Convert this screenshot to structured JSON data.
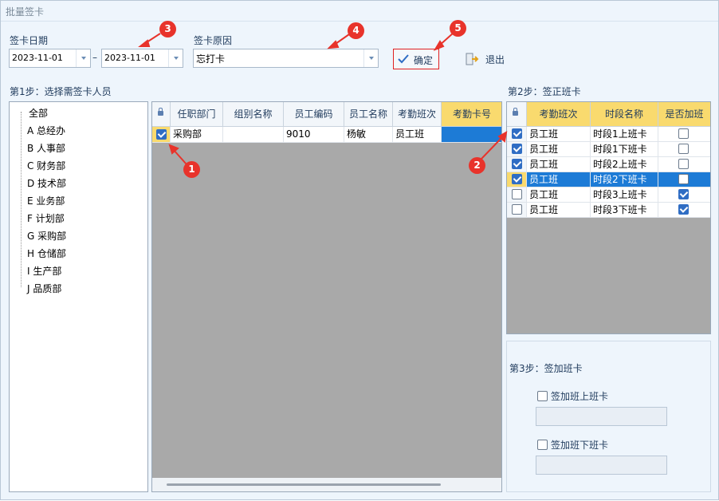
{
  "window": {
    "title": "批量签卡"
  },
  "form": {
    "date_label": "签卡日期",
    "date_from": "2023-11-01",
    "date_sep": "–",
    "date_to": "2023-11-01",
    "reason_label": "签卡原因",
    "reason_value": "忘打卡",
    "confirm_label": "确定",
    "exit_label": "退出"
  },
  "step1": {
    "title": "第1步：选择需签卡人员",
    "tree": [
      "全部",
      "A 总经办",
      "B 人事部",
      "C 财务部",
      "D 技术部",
      "E 业务部",
      "F 计划部",
      "G 采购部",
      "H 仓储部",
      "I 生产部",
      "J 品质部"
    ],
    "columns": [
      "任职部门",
      "组别名称",
      "员工编码",
      "员工名称",
      "考勤班次",
      "考勤卡号"
    ],
    "rows": [
      {
        "checked": true,
        "cells": [
          "采购部",
          "",
          "9010",
          "杨敏",
          "员工班",
          ""
        ]
      }
    ]
  },
  "step2": {
    "title": "第2步：签正班卡",
    "columns": [
      "考勤班次",
      "时段名称",
      "是否加班"
    ],
    "rows": [
      {
        "checked": true,
        "shift": "员工班",
        "period": "时段1上班卡",
        "overtime": false
      },
      {
        "checked": true,
        "shift": "员工班",
        "period": "时段1下班卡",
        "overtime": false
      },
      {
        "checked": true,
        "shift": "员工班",
        "period": "时段2上班卡",
        "overtime": false
      },
      {
        "checked": true,
        "shift": "员工班",
        "period": "时段2下班卡",
        "overtime": false
      },
      {
        "checked": false,
        "shift": "员工班",
        "period": "时段3上班卡",
        "overtime": true
      },
      {
        "checked": false,
        "shift": "员工班",
        "period": "时段3下班卡",
        "overtime": true
      }
    ]
  },
  "step3": {
    "title": "第3步：签加班卡",
    "opt_on": "签加班上班卡",
    "opt_off": "签加班下班卡"
  },
  "annotations": [
    "1",
    "2",
    "3",
    "4",
    "5"
  ],
  "colors": {
    "accent": "#1d7bd6",
    "annotation": "#e8332b",
    "header_highlight": "#f9da6e"
  }
}
